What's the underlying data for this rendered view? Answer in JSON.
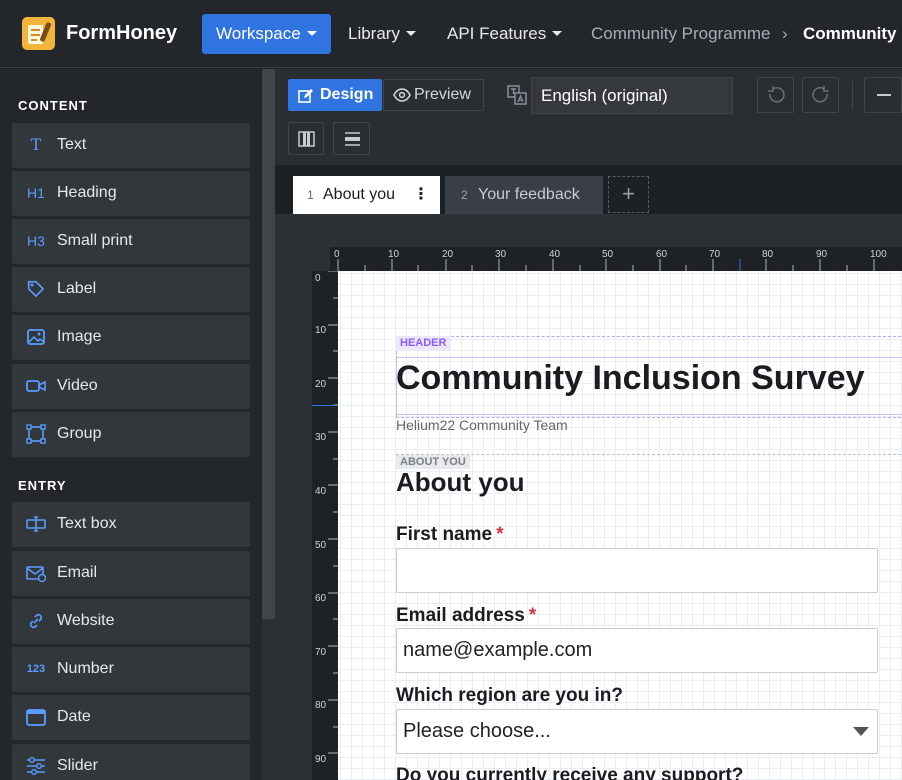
{
  "app": {
    "name": "FormHoney"
  },
  "nav": {
    "items": [
      {
        "label": "Workspace",
        "active": true
      },
      {
        "label": "Library",
        "active": false
      },
      {
        "label": "API Features",
        "active": false
      }
    ],
    "breadcrumb": [
      "Community Programme",
      "Community I"
    ]
  },
  "sidebar": {
    "content_heading": "CONTENT",
    "content_items": [
      {
        "icon": "text-icon",
        "glyph": "T",
        "label": "Text"
      },
      {
        "icon": "heading-icon",
        "glyph": "H1",
        "label": "Heading"
      },
      {
        "icon": "small-print-icon",
        "glyph": "H3",
        "label": "Small print"
      },
      {
        "icon": "tag-icon",
        "glyph": "",
        "label": "Label"
      },
      {
        "icon": "image-icon",
        "glyph": "",
        "label": "Image"
      },
      {
        "icon": "video-icon",
        "glyph": "",
        "label": "Video"
      },
      {
        "icon": "group-icon",
        "glyph": "",
        "label": "Group"
      }
    ],
    "entry_heading": "ENTRY",
    "entry_items": [
      {
        "icon": "text-box-icon",
        "glyph": "",
        "label": "Text box"
      },
      {
        "icon": "email-icon",
        "glyph": "",
        "label": "Email"
      },
      {
        "icon": "link-icon",
        "glyph": "",
        "label": "Website"
      },
      {
        "icon": "number-icon",
        "glyph": "123",
        "label": "Number"
      },
      {
        "icon": "calendar-icon",
        "glyph": "",
        "label": "Date"
      },
      {
        "icon": "slider-icon",
        "glyph": "",
        "label": "Slider"
      }
    ]
  },
  "toolbar": {
    "design_label": "Design",
    "preview_label": "Preview",
    "language": "English (original)"
  },
  "tabs": [
    {
      "num": "1",
      "label": "About you",
      "active": true
    },
    {
      "num": "2",
      "label": "Your feedback",
      "active": false
    }
  ],
  "rulers": {
    "top": [
      "0",
      "10",
      "20",
      "30",
      "40",
      "50",
      "60",
      "70",
      "80",
      "90",
      "100"
    ],
    "left": [
      "0",
      "10",
      "20",
      "30",
      "40",
      "50",
      "60",
      "70",
      "80",
      "90"
    ]
  },
  "form": {
    "header_badge": "HEADER",
    "title": "Community Inclusion Survey",
    "subtitle": "Helium22 Community Team",
    "section_badge": "ABOUT YOU",
    "section_title": "About you",
    "fields": [
      {
        "label": "First name",
        "required": true,
        "value": ""
      },
      {
        "label": "Email address",
        "required": true,
        "value": "name@example.com"
      },
      {
        "label": "Which region are you in?",
        "required": false,
        "value": "Please choose..."
      }
    ],
    "next_question_partial": "Do you currently receive any support?"
  },
  "colors": {
    "accent": "#2f74e0",
    "logo": "#f3b43c",
    "required": "#d9333f",
    "header_badge": "#8b5cf6"
  }
}
